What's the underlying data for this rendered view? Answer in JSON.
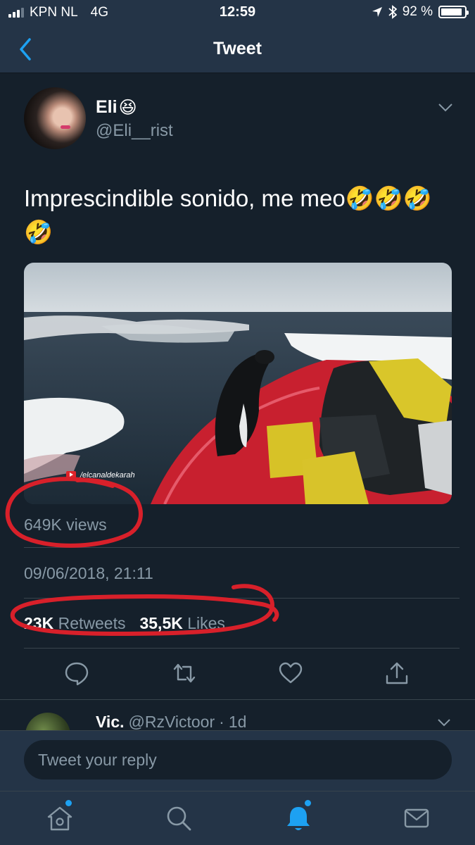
{
  "status_bar": {
    "carrier": "KPN NL",
    "network": "4G",
    "time": "12:59",
    "battery_text": "92 %",
    "battery_level": 0.92
  },
  "nav": {
    "title": "Tweet",
    "back_icon": "chevron-left-icon"
  },
  "tweet": {
    "author_name": "Eli",
    "author_emoji": "😆",
    "author_handle": "@Eli__rist",
    "text": "Imprescindible sonido, me meo🤣🤣🤣🤣",
    "media": {
      "watermark": "/elcanaldekarah"
    },
    "views": "649K views",
    "timestamp": "09/06/2018, 21:11",
    "retweets_count": "23K",
    "retweets_label": "Retweets",
    "likes_count": "35,5K",
    "likes_label": "Likes"
  },
  "actions": [
    {
      "icon": "reply-icon"
    },
    {
      "icon": "retweet-icon"
    },
    {
      "icon": "like-icon"
    },
    {
      "icon": "share-icon"
    }
  ],
  "reply_preview": {
    "name": "Vic.",
    "handle": "@RzVictoor",
    "separator": "·",
    "age": "1d"
  },
  "reply_bar": {
    "placeholder": "Tweet your reply"
  },
  "tab_bar": [
    {
      "icon": "home-icon",
      "badge": true
    },
    {
      "icon": "search-icon",
      "badge": false
    },
    {
      "icon": "notifications-icon",
      "badge": true,
      "active": true
    },
    {
      "icon": "messages-icon",
      "badge": false
    }
  ],
  "colors": {
    "background": "#15202b",
    "bar": "#243447",
    "accent": "#1da1f2",
    "muted_text": "#8899a6",
    "annotation": "#d8202a"
  }
}
